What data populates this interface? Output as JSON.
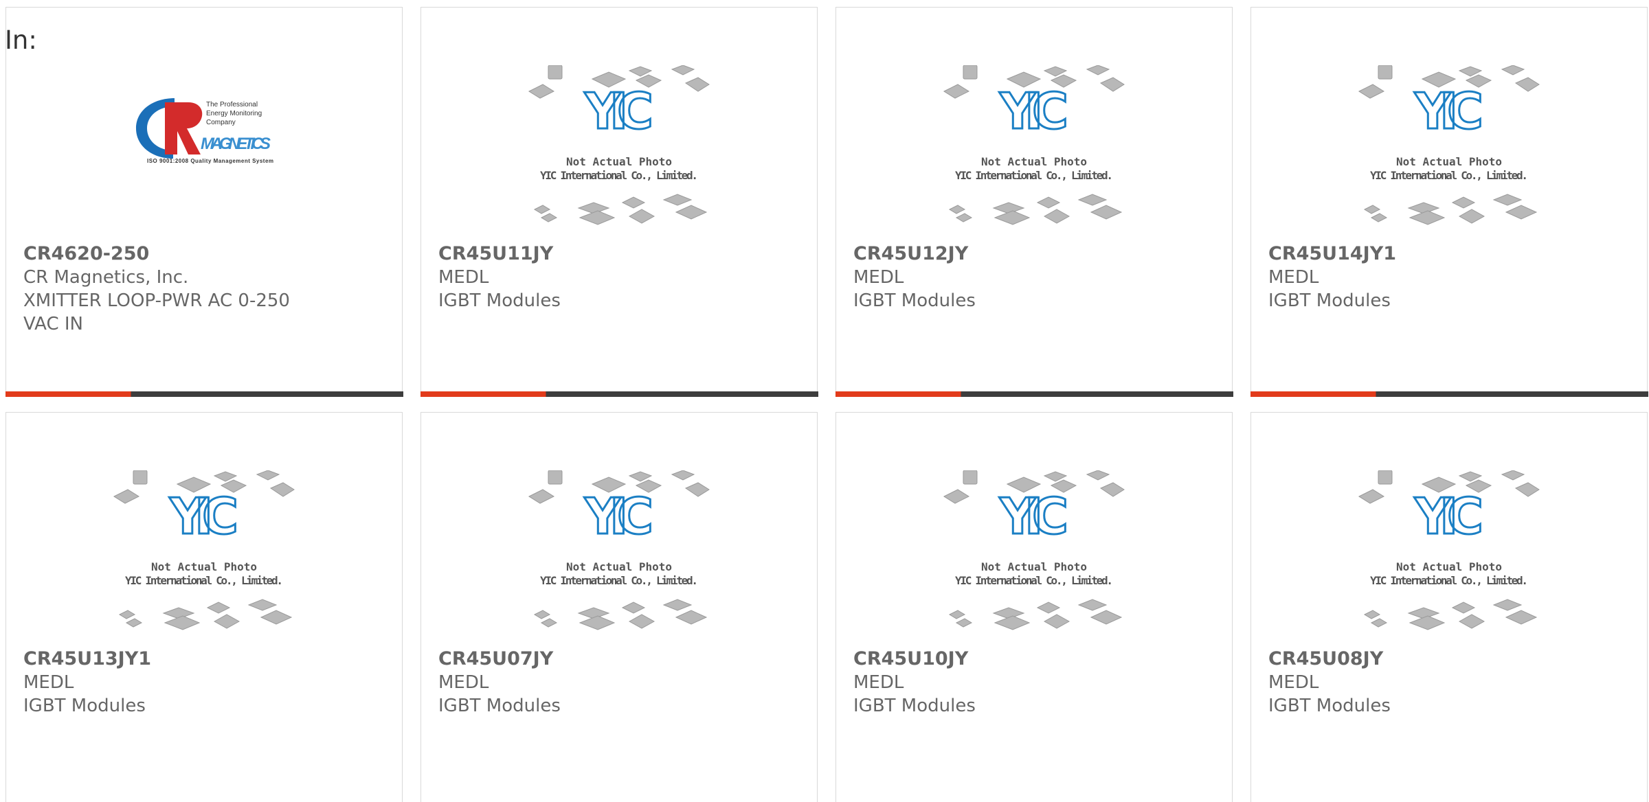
{
  "page": {
    "prefix_label": "In:"
  },
  "colors": {
    "accent_bar": "#e23b1b",
    "bar_dark": "#3d3d3d",
    "card_text": "#666666",
    "yic_blue": "#1b7fc4"
  },
  "placeholder_image": {
    "line1": "Not Actual Photo",
    "line2": "YIC International Co., Limited.",
    "logo_text": "YIC"
  },
  "cr_logo": {
    "tagline_1": "The Professional",
    "tagline_2": "Energy Monitoring",
    "tagline_3": "Company",
    "brand": "MAGNETICS",
    "iso": "ISO 9001:2008 Quality Management System"
  },
  "products": [
    {
      "part_number": "CR4620-250",
      "manufacturer": "CR Magnetics, Inc.",
      "description": "XMITTER LOOP-PWR AC 0-250 VAC IN",
      "image": "cr-magnetics-logo"
    },
    {
      "part_number": "CR45U11JY",
      "manufacturer": "MEDL",
      "description": "IGBT Modules",
      "image": "yic-placeholder"
    },
    {
      "part_number": "CR45U12JY",
      "manufacturer": "MEDL",
      "description": "IGBT Modules",
      "image": "yic-placeholder"
    },
    {
      "part_number": "CR45U14JY1",
      "manufacturer": "MEDL",
      "description": "IGBT Modules",
      "image": "yic-placeholder"
    },
    {
      "part_number": "CR45U13JY1",
      "manufacturer": "MEDL",
      "description": "IGBT Modules",
      "image": "yic-placeholder"
    },
    {
      "part_number": "CR45U07JY",
      "manufacturer": "MEDL",
      "description": "IGBT Modules",
      "image": "yic-placeholder"
    },
    {
      "part_number": "CR45U10JY",
      "manufacturer": "MEDL",
      "description": "IGBT Modules",
      "image": "yic-placeholder"
    },
    {
      "part_number": "CR45U08JY",
      "manufacturer": "MEDL",
      "description": "IGBT Modules",
      "image": "yic-placeholder"
    }
  ]
}
